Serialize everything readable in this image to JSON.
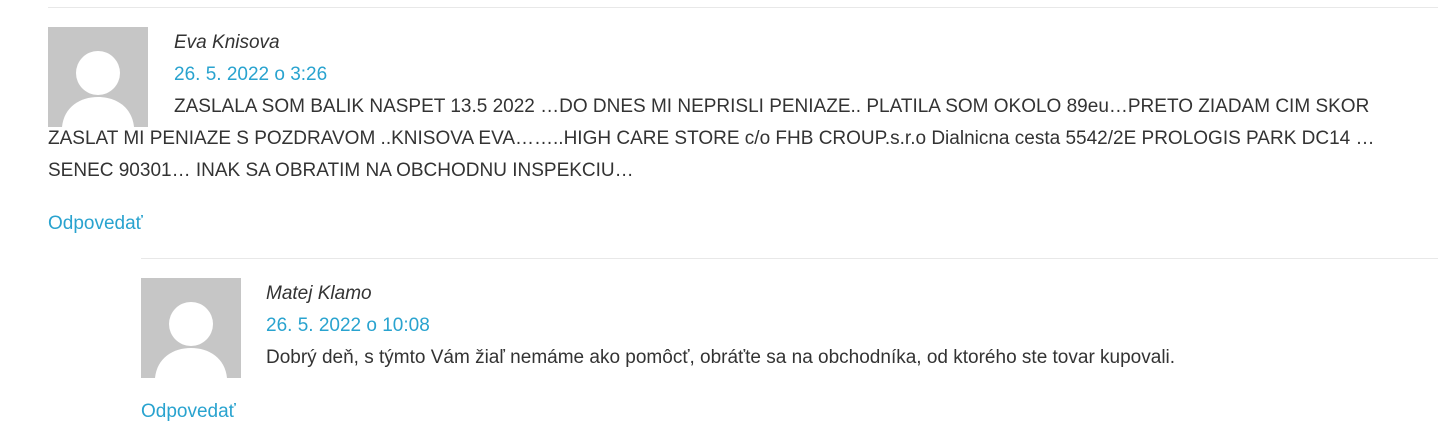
{
  "comments": [
    {
      "author": "Eva Knisova",
      "date": "26. 5. 2022 o 3:26",
      "text": "ZASLALA SOM BALIK NASPET 13.5 2022 …DO DNES MI NEPRISLI PENIAZE.. PLATILA SOM OKOLO 89eu…PRETO ZIADAM CIM SKOR ZASLAT MI PENIAZE S POZDRAVOM ..KNISOVA EVA……..HIGH CARE STORE c/o FHB CROUP.s.r.o Dialnicna cesta 5542/2E PROLOGIS PARK DC14 …SENEC 90301… INAK SA OBRATIM NA OBCHODNU INSPEKCIU…",
      "reply_label": "Odpovedať"
    },
    {
      "author": "Matej Klamo",
      "date": "26. 5. 2022 o 10:08",
      "text": "Dobrý deň, s týmto Vám žiaľ nemáme ako pomôcť, obráťte sa na obchodníka, od ktorého ste tovar kupovali.",
      "reply_label": "Odpovedať"
    }
  ],
  "icons": {
    "avatar": "user-silhouette-icon"
  },
  "colors": {
    "link": "#29a3cf",
    "text": "#333333",
    "avatar_bg": "#c6c6c6",
    "avatar_figure": "#ffffff",
    "divider": "#e8e8e8"
  }
}
